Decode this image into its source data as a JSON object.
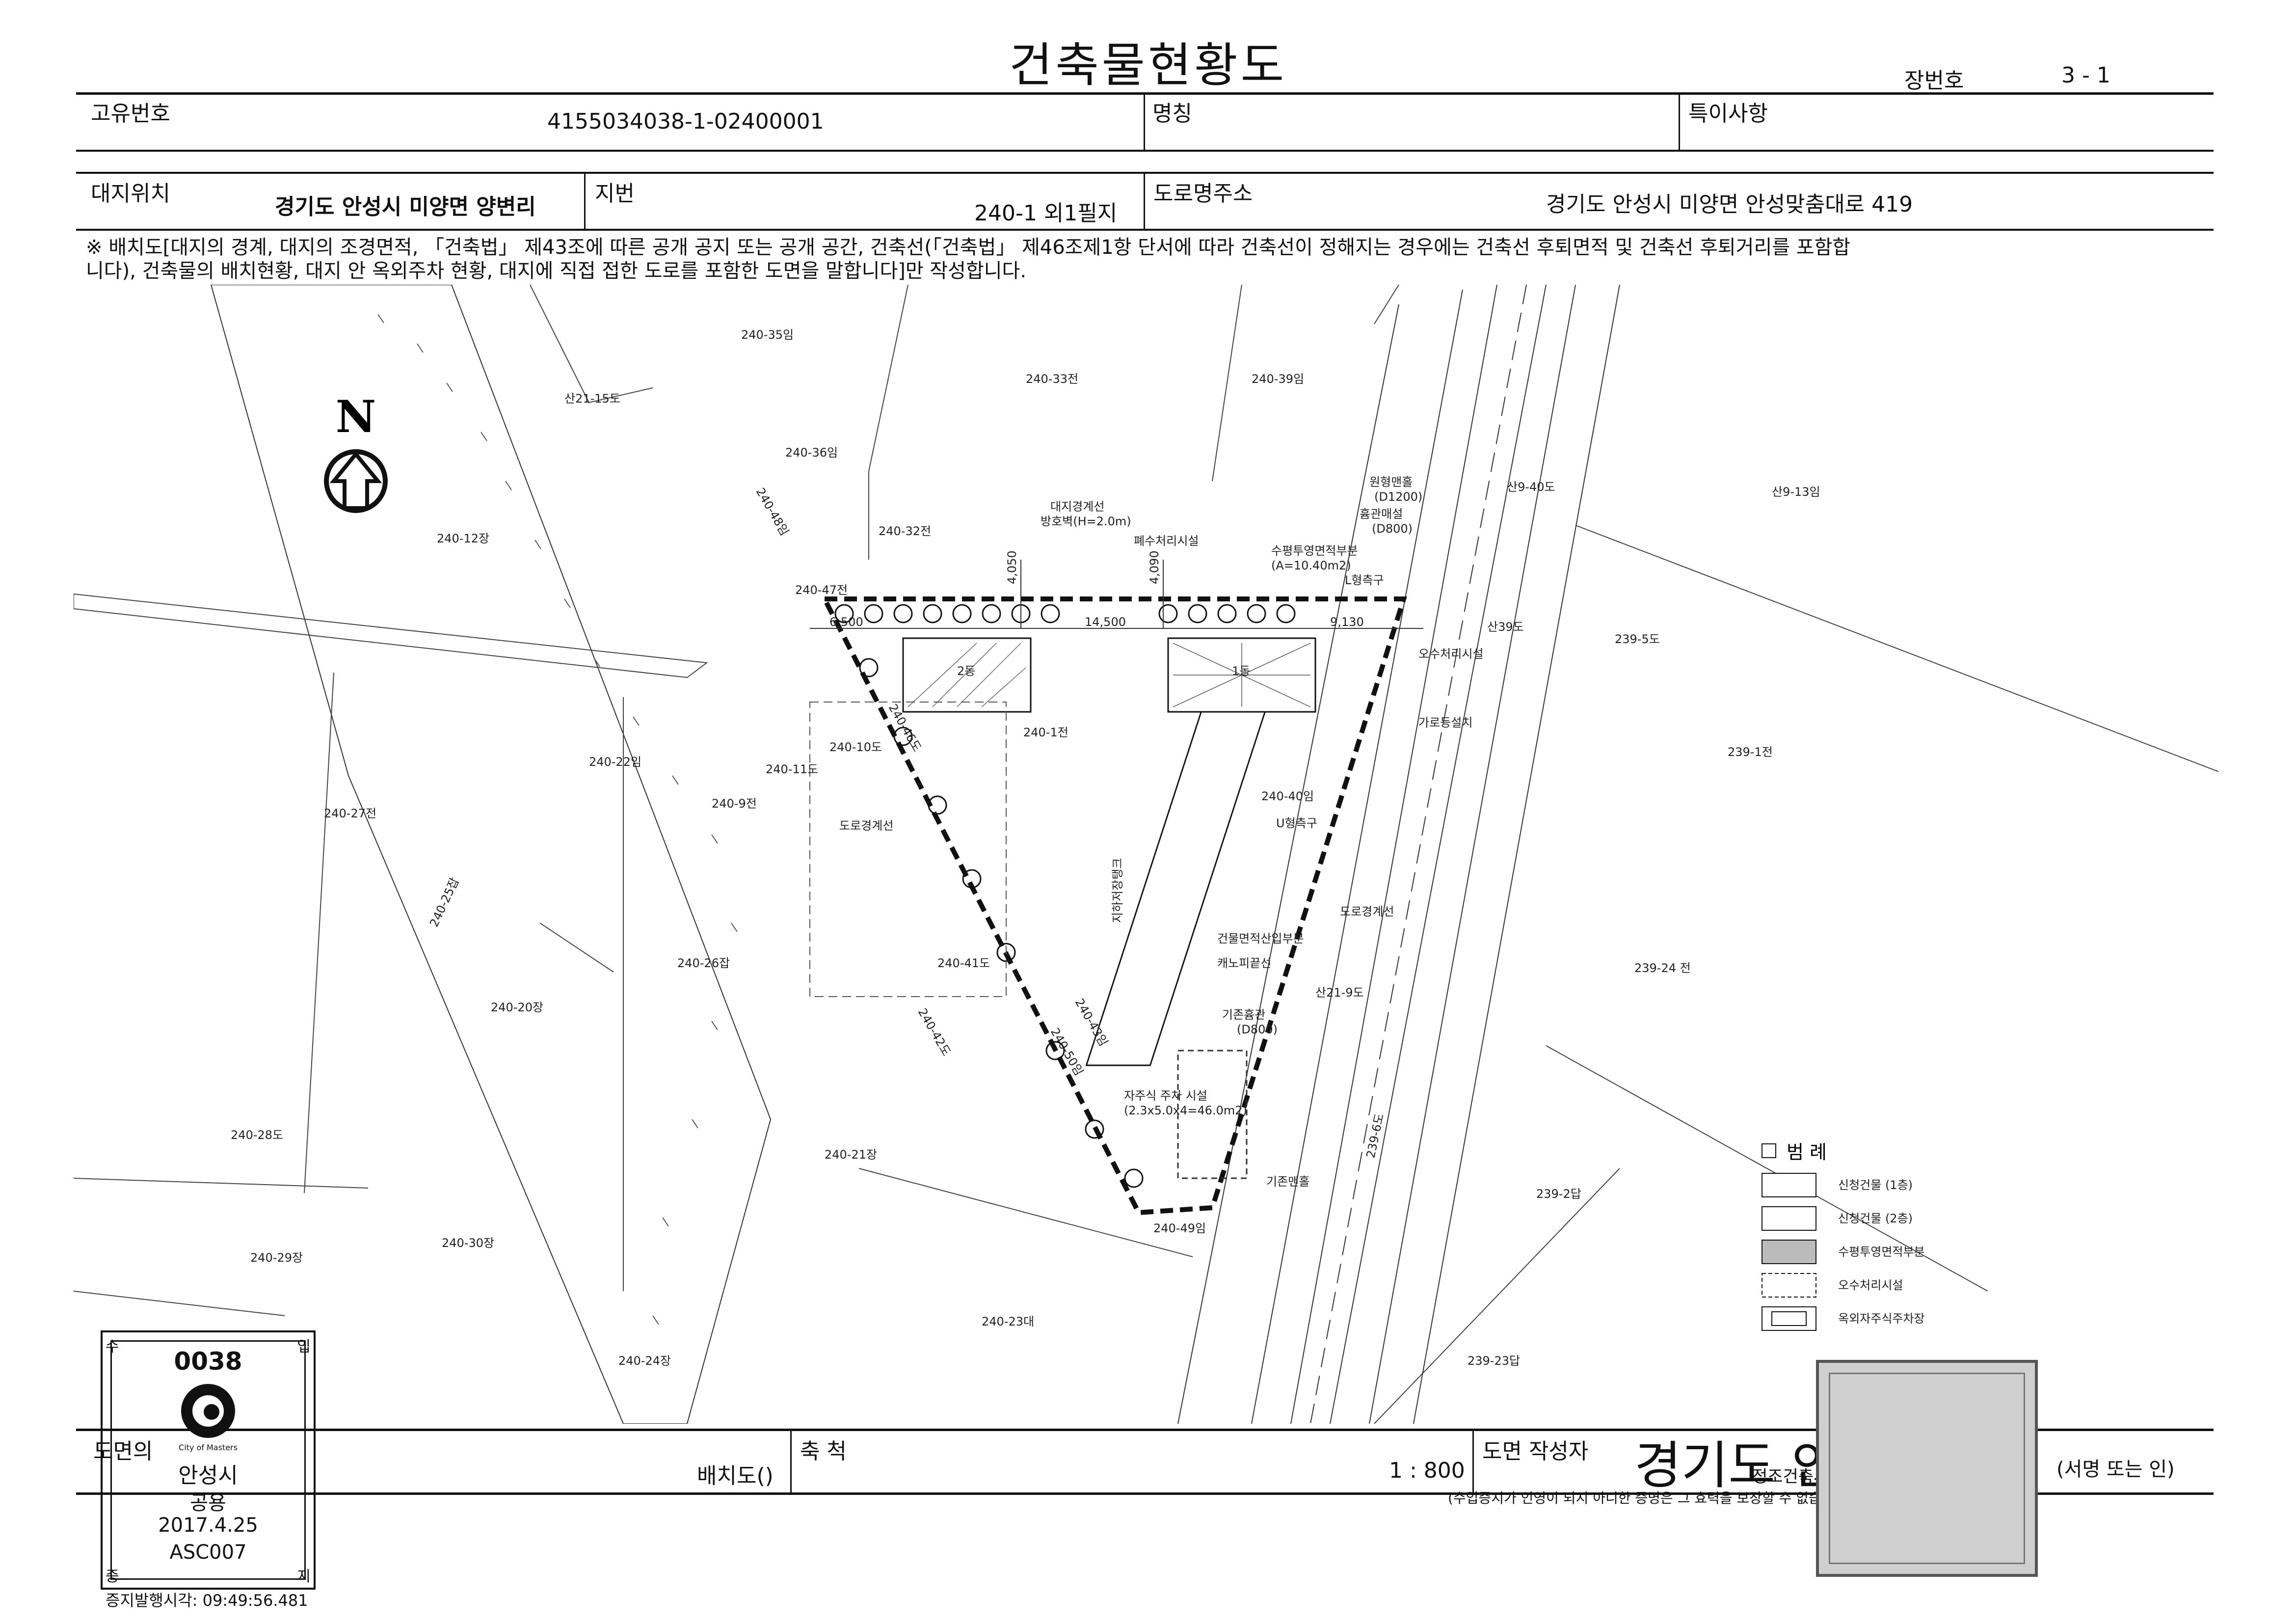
{
  "document": {
    "title": "건축물현황도",
    "sheet_number_label": "장번호",
    "sheet_number": "3 - 1"
  },
  "row1": {
    "id_label": "고유번호",
    "id_value": "4155034038-1-02400001",
    "name_label": "명칭",
    "name_value": "",
    "special_label": "특이사항",
    "special_value": ""
  },
  "row2": {
    "site_label": "대지위치",
    "site_value": "경기도 안성시 미양면 양변리",
    "lot_label": "지번",
    "lot_value": "240-1 외1필지",
    "road_label": "도로명주소",
    "road_value": "경기도 안성시 미양면 안성맞춤대로 419"
  },
  "note": {
    "line1": "※ 배치도[대지의 경계, 대지의 조경면적, 「건축법」 제43조에 따른 공개 공지 또는 공개 공간, 건축선(「건축법」 제46조제1항 단서에 따라 건축선이 정해지는 경우에는 건축선 후퇴면적 및 건축선 후퇴거리를 포함합",
    "line2": "니다), 건축물의 배치현황, 대지 안 옥외주차 현황, 대지에 직접 접한 도로를 포함한 도면을 말합니다]만 작성합니다."
  },
  "plan": {
    "north": "N",
    "parcels": {
      "p1": "240-35임",
      "p2": "240-33전",
      "p3": "240-39임",
      "p4": "산21-15도",
      "p5": "240-36임",
      "p6": "240-32전",
      "p7": "240-12장",
      "p8": "240-47전",
      "p9": "240-48임",
      "p10": "산9-40도",
      "p11": "산9-13임",
      "p12": "240-46도",
      "p13": "240-10도",
      "p14": "240-1전",
      "p15": "240-22임",
      "p16": "240-11도",
      "p17": "240-9전",
      "p18": "240-27전",
      "p19": "240-40임",
      "p20": "239-5도",
      "p21": "239-1전",
      "p22": "240-25잡",
      "p23": "240-26잡",
      "p24": "240-41도",
      "p25": "240-20장",
      "p26": "240-43임",
      "p27": "240-42도",
      "p28": "240-50임",
      "p29": "239-24 전",
      "p30": "240-28도",
      "p31": "240-21장",
      "p32": "239-6도",
      "p33": "239-2답",
      "p34": "240-29장",
      "p35": "240-30장",
      "p36": "240-49임",
      "p37": "240-23대",
      "p38": "240-24장",
      "p39": "239-23답",
      "p40": "산21-9도",
      "p41": "산39도"
    },
    "annotations": {
      "a1": "대지경계선",
      "a2": "방호벽(H=2.0m)",
      "a3": "폐수처리시설",
      "a4": "수평투영면적부분",
      "a5": "(A=10.40m2)",
      "a6": "L형측구",
      "a7": "원형맨홀",
      "a8": "(D1200)",
      "a9": "흄관매설",
      "a10": "(D800)",
      "a11": "오수처리시설",
      "a12": "가로등설치",
      "a13": "도로경계선",
      "a14": "U형측구",
      "a15": "도로경계선",
      "a16": "건물면적산입부분",
      "a17": "캐노피끝선",
      "a18": "기존흄관",
      "a19": "(D800)",
      "a20": "자주식 주차 시설",
      "a21": "(2.3x5.0x4=46.0m2)",
      "a22": "기존맨홀",
      "a23": "지하저장탱크",
      "a24": "2동",
      "a25": "1동"
    },
    "dimensions": {
      "d1": "6,500",
      "d2": "4,050",
      "d3": "14,500",
      "d4": "4,090",
      "d5": "9,130"
    }
  },
  "legend": {
    "title": "범 례",
    "items": [
      "신청건물 (1층)",
      "신청건물 (2층)",
      "수평투영면적부분",
      "오수처리시설",
      "옥외자주식주차장"
    ]
  },
  "footer": {
    "drawing_type_label": "도면의",
    "drawing_type_value": "배치도()",
    "scale_label": "축 척",
    "scale_value": "1 : 800",
    "author_label": "도면 작성자",
    "author_value": "경기도 안성시장",
    "author_overprint": "정조건축사사무소 박정남",
    "sign_hint": "(서명 또는 인)",
    "disclaimer": "(수입증지가 인영이 되지 아니한 증명은 그 효력을 보장할 수 없습니다)"
  },
  "issue_stamp": {
    "serial": "0038",
    "corner_tl": "수",
    "corner_tr": "입",
    "corner_bl": "증",
    "corner_br": "지",
    "logo_caption": "City of Masters",
    "city": "안성시",
    "purpose": "공용",
    "date": "2017.4.25",
    "code": "ASC007",
    "issue_time": "증지발행시각: 09:49:56.481"
  }
}
